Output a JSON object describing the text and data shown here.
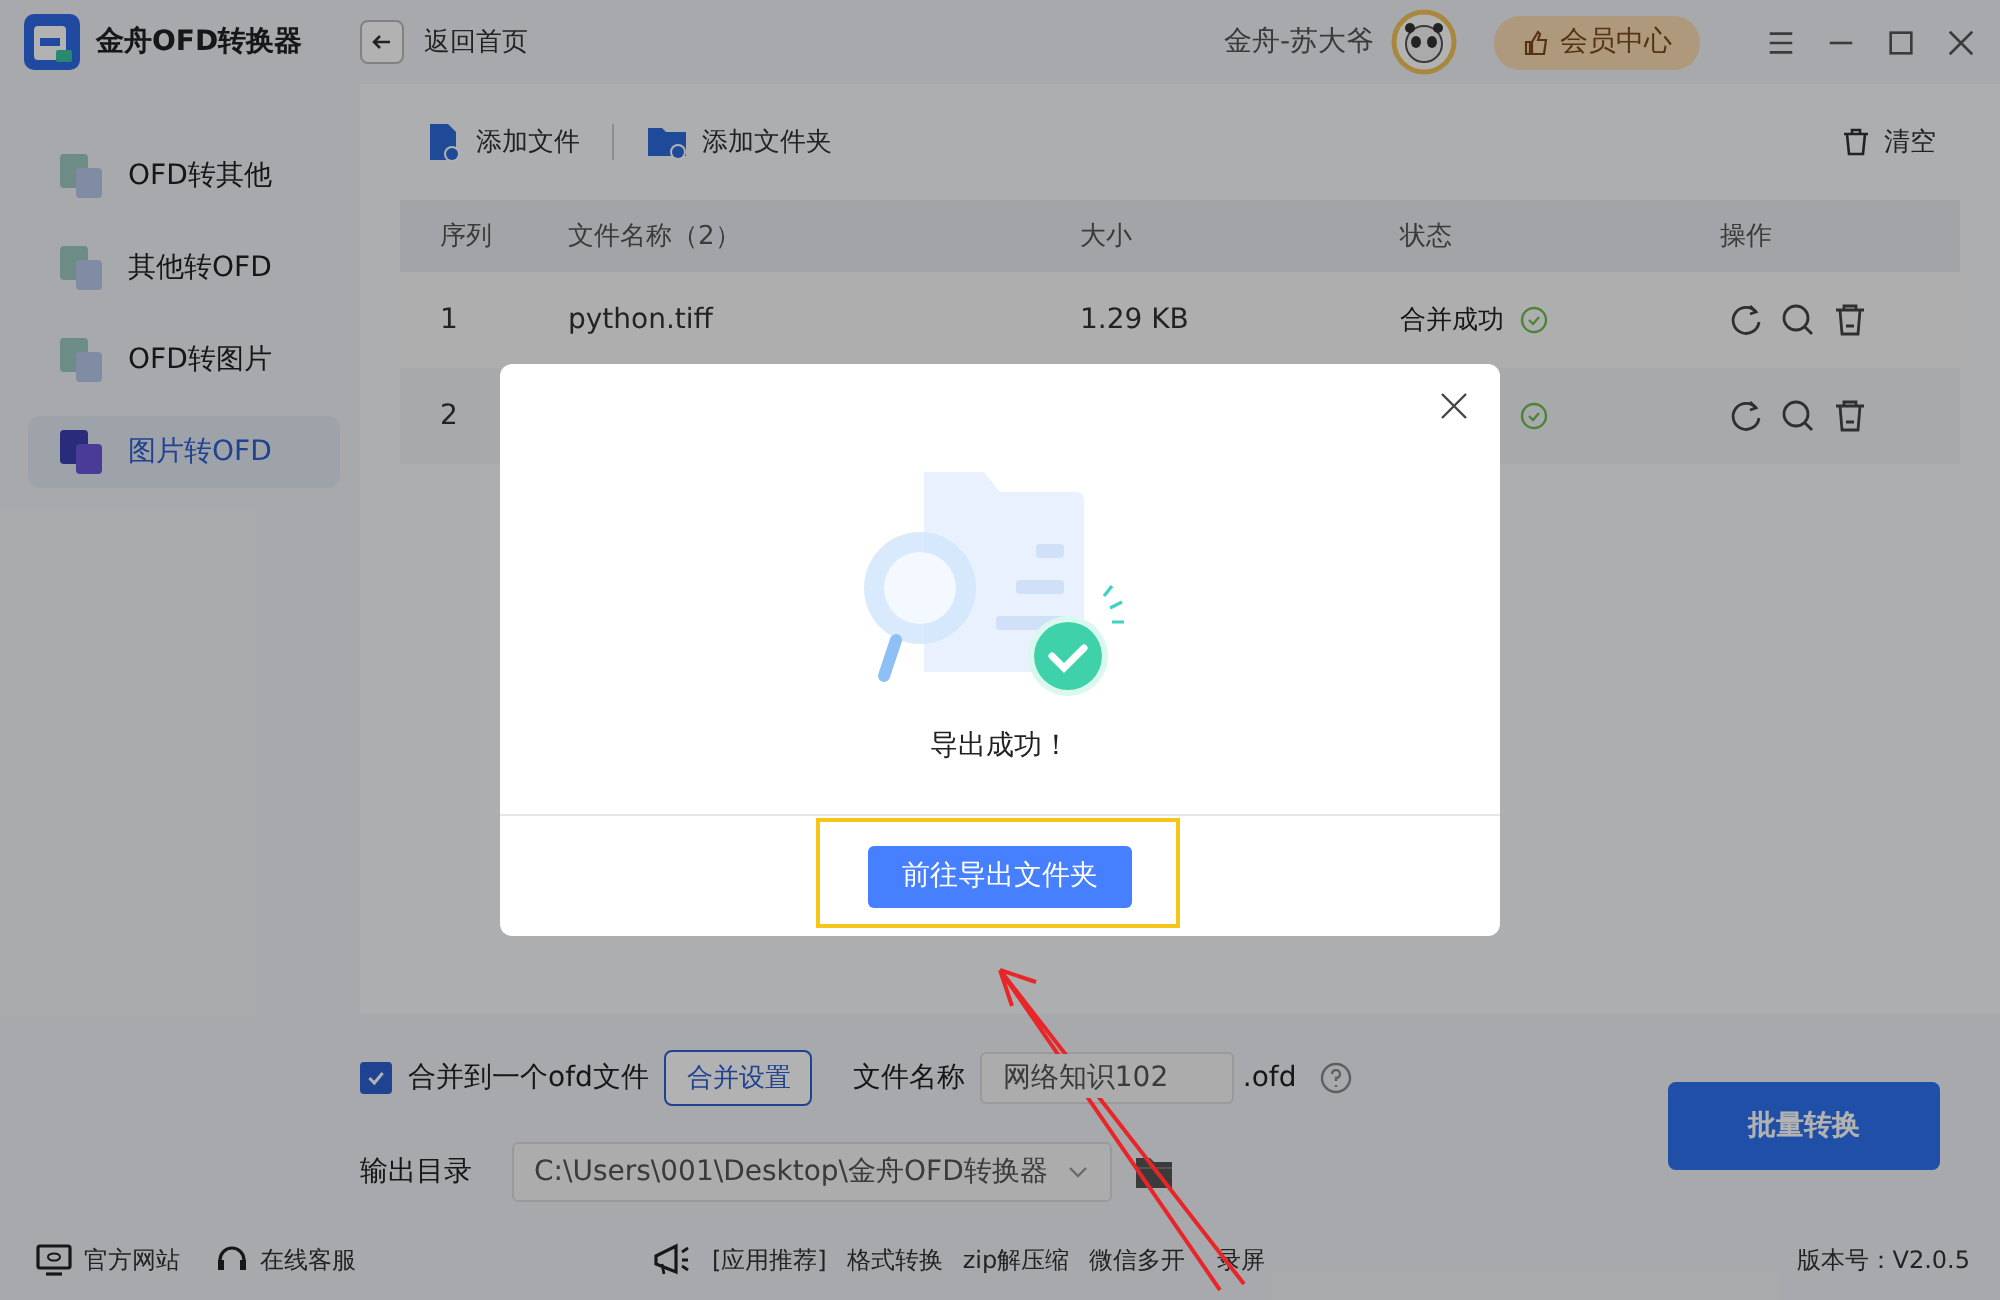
{
  "app": {
    "title": "金舟OFD转换器",
    "back": "返回首页",
    "user": "金舟-苏大爷",
    "vip": "会员中心"
  },
  "sidebar": {
    "items": [
      {
        "label": "OFD转其他",
        "selected": false
      },
      {
        "label": "其他转OFD",
        "selected": false
      },
      {
        "label": "OFD转图片",
        "selected": false
      },
      {
        "label": "图片转OFD",
        "selected": true
      }
    ]
  },
  "toolbar": {
    "add_file": "添加文件",
    "add_folder": "添加文件夹",
    "clear": "清空"
  },
  "table": {
    "columns": [
      "序列",
      "文件名称（2）",
      "大小",
      "状态",
      "操作"
    ],
    "rows": [
      {
        "index": "1",
        "name": "python.tiff",
        "size": "1.29 KB",
        "status": "合并成功",
        "success": true
      },
      {
        "index": "2",
        "success": true
      }
    ]
  },
  "settings": {
    "merge_label": "合并到一个ofd文件",
    "merge_checked": true,
    "merge_settings": "合并设置",
    "file_name_label": "文件名称",
    "file_name": "网络知识102",
    "extension": ".ofd",
    "output_label": "输出目录",
    "output_dir": "C:\\Users\\001\\Desktop\\金舟OFD转换器",
    "convert": "批量转换"
  },
  "footer": {
    "website": "官方网站",
    "support": "在线客服",
    "links": [
      "[应用推荐]",
      "格式转换",
      "zip解压缩",
      "微信多开",
      "录屏"
    ],
    "version": "版本号：V2.0.5"
  },
  "dialog": {
    "message": "导出成功！",
    "button": "前往导出文件夹"
  }
}
